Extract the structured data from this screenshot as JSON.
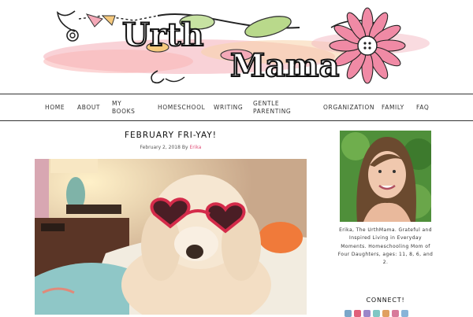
{
  "site": {
    "logo_line1": "Urth",
    "logo_line2": "Mama"
  },
  "nav": {
    "items": [
      {
        "key": "home",
        "label": "HOME"
      },
      {
        "key": "about",
        "label": "ABOUT"
      },
      {
        "key": "my-books",
        "line1": "MY",
        "line2": "BOOKS"
      },
      {
        "key": "homeschool",
        "label": "HOMESCHOOL"
      },
      {
        "key": "writing",
        "label": "WRITING"
      },
      {
        "key": "gentle-parenting",
        "line1": "GENTLE",
        "line2": "PARENTING"
      },
      {
        "key": "organization",
        "label": "ORGANIZATION"
      },
      {
        "key": "family",
        "label": "FAMILY"
      },
      {
        "key": "faq",
        "label": "FAQ"
      }
    ]
  },
  "post": {
    "title": "FEBRUARY FRI-YAY!",
    "date": "February 2, 2018",
    "by": "By",
    "author": "Erika",
    "image_icon": "dog-with-heart-sunglasses-photo"
  },
  "sidebar": {
    "profile_icon": "author-portrait-photo",
    "bio": "Erika, The UrthMama. Grateful and Inspired Living in Everyday Moments. Homeschooling Mom of Four Daughters, ages: 11, 8, 6, and 2.",
    "connect_heading": "CONNECT!",
    "social_colors": [
      "#7aa6c9",
      "#e0607a",
      "#9b86c9",
      "#7fc7c4",
      "#e0a060",
      "#d87a9a",
      "#88b4d8"
    ]
  },
  "colors": {
    "accent_pink": "#e0507a",
    "nav_border": "#333333"
  }
}
